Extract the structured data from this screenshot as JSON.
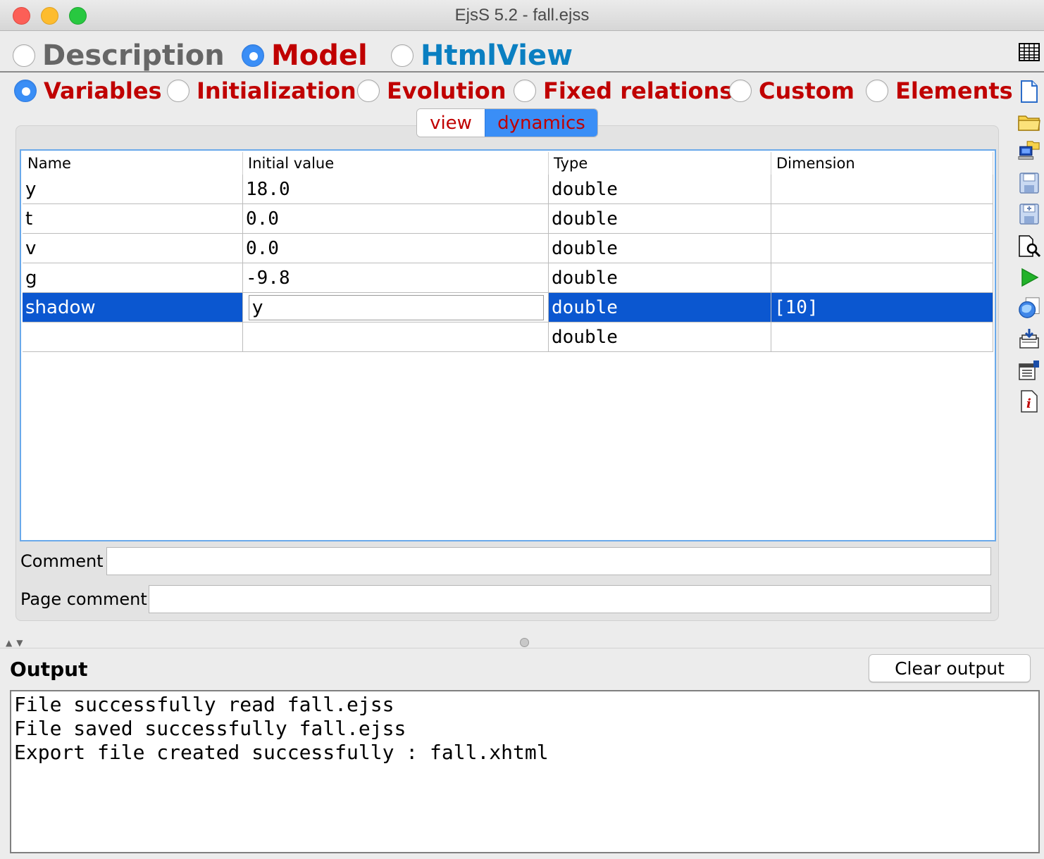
{
  "window": {
    "title": "EjsS 5.2 - fall.ejss"
  },
  "main_tabs": [
    {
      "label": "Description",
      "selected": false,
      "color": "#666666"
    },
    {
      "label": "Model",
      "selected": true,
      "color": "#c00000"
    },
    {
      "label": "HtmlView",
      "selected": false,
      "color": "#0a7fc1"
    }
  ],
  "model_tabs": [
    {
      "label": "Variables",
      "selected": true
    },
    {
      "label": "Initialization",
      "selected": false
    },
    {
      "label": "Evolution",
      "selected": false
    },
    {
      "label": "Fixed relations",
      "selected": false
    },
    {
      "label": "Custom",
      "selected": false
    },
    {
      "label": "Elements",
      "selected": false
    }
  ],
  "pages": {
    "view": "view",
    "dynamics": "dynamics",
    "active": "dynamics"
  },
  "table": {
    "columns": [
      "Name",
      "Initial value",
      "Type",
      "Dimension"
    ],
    "rows": [
      {
        "name": "y",
        "value": "18.0",
        "type": "double",
        "dimension": ""
      },
      {
        "name": "t",
        "value": "0.0",
        "type": "double",
        "dimension": ""
      },
      {
        "name": "v",
        "value": "0.0",
        "type": "double",
        "dimension": ""
      },
      {
        "name": "g",
        "value": "-9.8",
        "type": "double",
        "dimension": ""
      },
      {
        "name": "shadow",
        "value": "y",
        "type": "double",
        "dimension": "[10]",
        "selected": true
      },
      {
        "name": "",
        "value": "",
        "type": "double",
        "dimension": ""
      }
    ]
  },
  "comment": {
    "label": "Comment",
    "value": ""
  },
  "page_comment": {
    "label": "Page comment",
    "value": ""
  },
  "output": {
    "title": "Output",
    "clear_label": "Clear output",
    "lines": [
      "File successfully read fall.ejss",
      "File saved successfully fall.ejss",
      "Export file created successfully : fall.xhtml"
    ]
  },
  "toolbar": [
    "list-icon",
    "new-file-icon",
    "open-folder-icon",
    "open-remote-icon",
    "save-icon",
    "save-as-icon",
    "search-icon",
    "run-icon",
    "web-icon",
    "package-icon",
    "options-icon",
    "info-icon"
  ]
}
